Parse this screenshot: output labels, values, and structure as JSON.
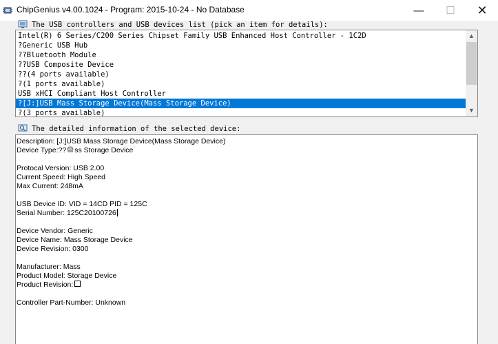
{
  "window": {
    "title": "ChipGenius v4.00.1024 - Program: 2015-10-24 - No Database",
    "minimize_glyph": "—",
    "maximize_glyph": "☐",
    "close_glyph": "✕"
  },
  "devices_list": {
    "label": "The USB controllers and USB devices list (pick an item for details):",
    "selected_index": 7,
    "items": [
      "Intel(R) 6 Series/C200 Series Chipset Family USB Enhanced Host Controller - 1C2D",
      "?Generic USB Hub",
      "??Bluetooth Module",
      "??USB Composite Device",
      "??(4 ports available)",
      "?(1 ports available)",
      "USB xHCI Compliant Host Controller",
      "?[J:]USB Mass Storage Device(Mass Storage Device)",
      "?(3 ports available)"
    ],
    "scroll_up": "▲",
    "scroll_down": "▼"
  },
  "details": {
    "label": "The detailed information of the selected device:",
    "description": "Description: [J:]USB Mass Storage Device(Mass Storage Device)",
    "device_type_prefix": "Device Type:??",
    "device_type_suffix": "ss Storage Device",
    "protocol_version": "Protocal Version: USB 2.00",
    "current_speed": "Current Speed: High Speed",
    "max_current": "Max Current: 248mA",
    "usb_device_id": "USB Device ID: VID = 14CD PID = 125C",
    "serial_number": "Serial Number: 125C20100726",
    "device_vendor": "Device Vendor: Generic",
    "device_name": "Device Name: Mass Storage Device",
    "device_revision": "Device Revision: 0300",
    "manufacturer": "Manufacturer: Mass",
    "product_model": "Product Model: Storage Device",
    "product_revision": "Product Revision:",
    "controller_part_number": "Controller Part-Number: Unknown"
  },
  "colors": {
    "selection": "#0078d7",
    "border": "#828790"
  }
}
